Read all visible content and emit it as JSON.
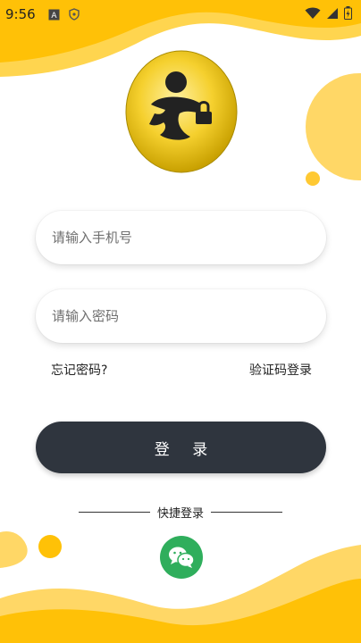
{
  "status_bar": {
    "time": "9:56",
    "icons": [
      "a-box-icon",
      "shield-icon",
      "wifi-icon",
      "signal-icon",
      "battery-icon"
    ]
  },
  "logo": {
    "icon": "runner-logo-icon"
  },
  "login_form": {
    "phone_placeholder": "请输入手机号",
    "phone_value": "",
    "password_placeholder": "请输入密码",
    "password_value": "",
    "forgot_password": "忘记密码?",
    "code_login": "验证码登录",
    "login_button": "登 录"
  },
  "quick_login": {
    "label": "快捷登录",
    "wechat_icon": "wechat-icon"
  },
  "colors": {
    "accent": "#FFC107",
    "accent_light": "#FFD766",
    "button_dark": "#2F353E",
    "wechat_green": "#2FAE5C"
  }
}
